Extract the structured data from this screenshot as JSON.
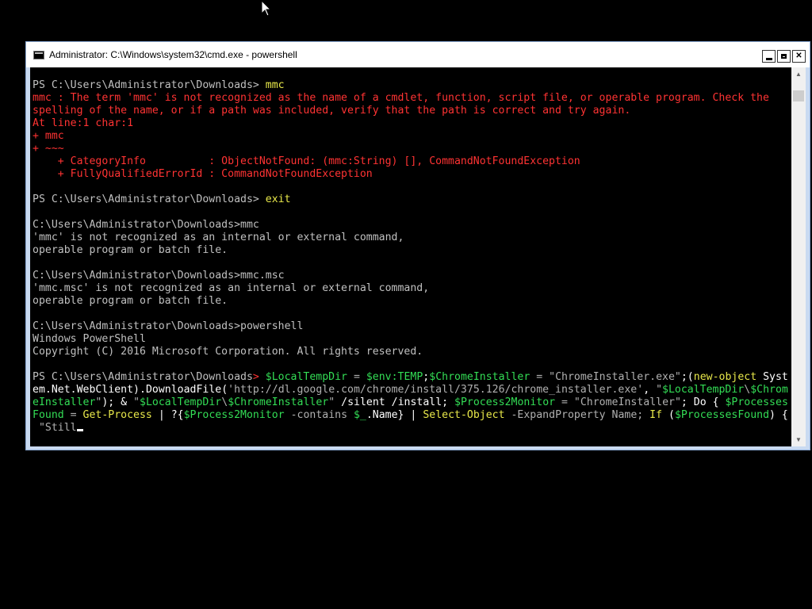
{
  "window": {
    "title": "Administrator: C:\\Windows\\system32\\cmd.exe - powershell",
    "icon": "console-app-icon",
    "minimize_label": "",
    "maximize_label": "",
    "close_label": "✕",
    "accent_color": "#c9daf1"
  },
  "console": {
    "lines": [
      {
        "segments": [
          {
            "text": "PS C:\\Users\\Administrator\\Downloads> ",
            "color": "gray"
          },
          {
            "text": "mmc",
            "color": "yellow"
          }
        ]
      },
      {
        "segments": [
          {
            "text": "mmc : The term 'mmc' is not recognized as the name of a cmdlet, function, script file, or operable program. Check the",
            "color": "red"
          }
        ]
      },
      {
        "segments": [
          {
            "text": "spelling of the name, or if a path was included, verify that the path is correct and try again.",
            "color": "red"
          }
        ]
      },
      {
        "segments": [
          {
            "text": "At line:1 char:1",
            "color": "red"
          }
        ]
      },
      {
        "segments": [
          {
            "text": "+ mmc",
            "color": "red"
          }
        ]
      },
      {
        "segments": [
          {
            "text": "+ ~~~",
            "color": "red"
          }
        ]
      },
      {
        "segments": [
          {
            "text": "    + CategoryInfo          : ObjectNotFound: (mmc:String) [], CommandNotFoundException",
            "color": "red"
          }
        ]
      },
      {
        "segments": [
          {
            "text": "    + FullyQualifiedErrorId : CommandNotFoundException",
            "color": "red"
          }
        ]
      },
      {
        "segments": [
          {
            "text": "",
            "color": "gray"
          }
        ]
      },
      {
        "segments": [
          {
            "text": "PS C:\\Users\\Administrator\\Downloads> ",
            "color": "gray"
          },
          {
            "text": "exit",
            "color": "yellow"
          }
        ]
      },
      {
        "segments": [
          {
            "text": "",
            "color": "gray"
          }
        ]
      },
      {
        "segments": [
          {
            "text": "C:\\Users\\Administrator\\Downloads>mmc",
            "color": "gray"
          }
        ]
      },
      {
        "segments": [
          {
            "text": "'mmc' is not recognized as an internal or external command,",
            "color": "gray"
          }
        ]
      },
      {
        "segments": [
          {
            "text": "operable program or batch file.",
            "color": "gray"
          }
        ]
      },
      {
        "segments": [
          {
            "text": "",
            "color": "gray"
          }
        ]
      },
      {
        "segments": [
          {
            "text": "C:\\Users\\Administrator\\Downloads>mmc.msc",
            "color": "gray"
          }
        ]
      },
      {
        "segments": [
          {
            "text": "'mmc.msc' is not recognized as an internal or external command,",
            "color": "gray"
          }
        ]
      },
      {
        "segments": [
          {
            "text": "operable program or batch file.",
            "color": "gray"
          }
        ]
      },
      {
        "segments": [
          {
            "text": "",
            "color": "gray"
          }
        ]
      },
      {
        "segments": [
          {
            "text": "C:\\Users\\Administrator\\Downloads>powershell",
            "color": "gray"
          }
        ]
      },
      {
        "segments": [
          {
            "text": "Windows PowerShell",
            "color": "gray"
          }
        ]
      },
      {
        "segments": [
          {
            "text": "Copyright (C) 2016 Microsoft Corporation. All rights reserved.",
            "color": "gray"
          }
        ]
      },
      {
        "segments": [
          {
            "text": "",
            "color": "gray"
          }
        ]
      },
      {
        "segments": [
          {
            "text": "PS C:\\Users\\Administrator\\Downloads",
            "color": "gray"
          },
          {
            "text": "> ",
            "color": "red"
          },
          {
            "text": "$LocalTempDir",
            "color": "green"
          },
          {
            "text": " = ",
            "color": "lightgray"
          },
          {
            "text": "$env:TEMP",
            "color": "green"
          },
          {
            "text": ";",
            "color": "white"
          },
          {
            "text": "$ChromeInstaller",
            "color": "green"
          },
          {
            "text": " = ",
            "color": "lightgray"
          },
          {
            "text": "\"ChromeInstaller.exe\"",
            "color": "lightgray"
          },
          {
            "text": ";(",
            "color": "white"
          },
          {
            "text": "new-object",
            "color": "yellow"
          },
          {
            "text": " Syst",
            "color": "white"
          }
        ]
      },
      {
        "segments": [
          {
            "text": "em.Net.WebClient",
            "color": "white"
          },
          {
            "text": ").",
            "color": "white"
          },
          {
            "text": "DownloadFile",
            "color": "white"
          },
          {
            "text": "(",
            "color": "white"
          },
          {
            "text": "'http://dl.google.com/chrome/install/375.126/chrome_installer.exe'",
            "color": "lightgray"
          },
          {
            "text": ", ",
            "color": "white"
          },
          {
            "text": "\"",
            "color": "lightgray"
          },
          {
            "text": "$LocalTempDir",
            "color": "green"
          },
          {
            "text": "\\",
            "color": "lightgray"
          },
          {
            "text": "$Chrom",
            "color": "green"
          }
        ]
      },
      {
        "segments": [
          {
            "text": "eInstaller",
            "color": "green"
          },
          {
            "text": "\"",
            "color": "lightgray"
          },
          {
            "text": "); & ",
            "color": "white"
          },
          {
            "text": "\"",
            "color": "lightgray"
          },
          {
            "text": "$LocalTempDir",
            "color": "green"
          },
          {
            "text": "\\",
            "color": "lightgray"
          },
          {
            "text": "$ChromeInstaller",
            "color": "green"
          },
          {
            "text": "\"",
            "color": "lightgray"
          },
          {
            "text": " /silent /install; ",
            "color": "white"
          },
          {
            "text": "$Process2Monitor",
            "color": "green"
          },
          {
            "text": " = ",
            "color": "lightgray"
          },
          {
            "text": "\"ChromeInstaller\"",
            "color": "lightgray"
          },
          {
            "text": "; Do { ",
            "color": "white"
          },
          {
            "text": "$Processes",
            "color": "green"
          }
        ]
      },
      {
        "segments": [
          {
            "text": "Found",
            "color": "green"
          },
          {
            "text": " = ",
            "color": "lightgray"
          },
          {
            "text": "Get-Process",
            "color": "yellow"
          },
          {
            "text": " | ?{",
            "color": "white"
          },
          {
            "text": "$Process2Monitor",
            "color": "green"
          },
          {
            "text": " -contains ",
            "color": "lightgray"
          },
          {
            "text": "$_",
            "color": "green"
          },
          {
            "text": ".Name} | ",
            "color": "white"
          },
          {
            "text": "Select-Object",
            "color": "yellow"
          },
          {
            "text": " -ExpandProperty Name; ",
            "color": "lightgray"
          },
          {
            "text": "If",
            "color": "yellow"
          },
          {
            "text": " (",
            "color": "white"
          },
          {
            "text": "$ProcessesFound",
            "color": "green"
          },
          {
            "text": ") {",
            "color": "white"
          }
        ]
      },
      {
        "segments": [
          {
            "text": " \"Still",
            "color": "lightgray"
          }
        ],
        "cursor": true
      }
    ]
  },
  "scrollbar": {
    "up_icon": "▲",
    "down_icon": "▼"
  }
}
